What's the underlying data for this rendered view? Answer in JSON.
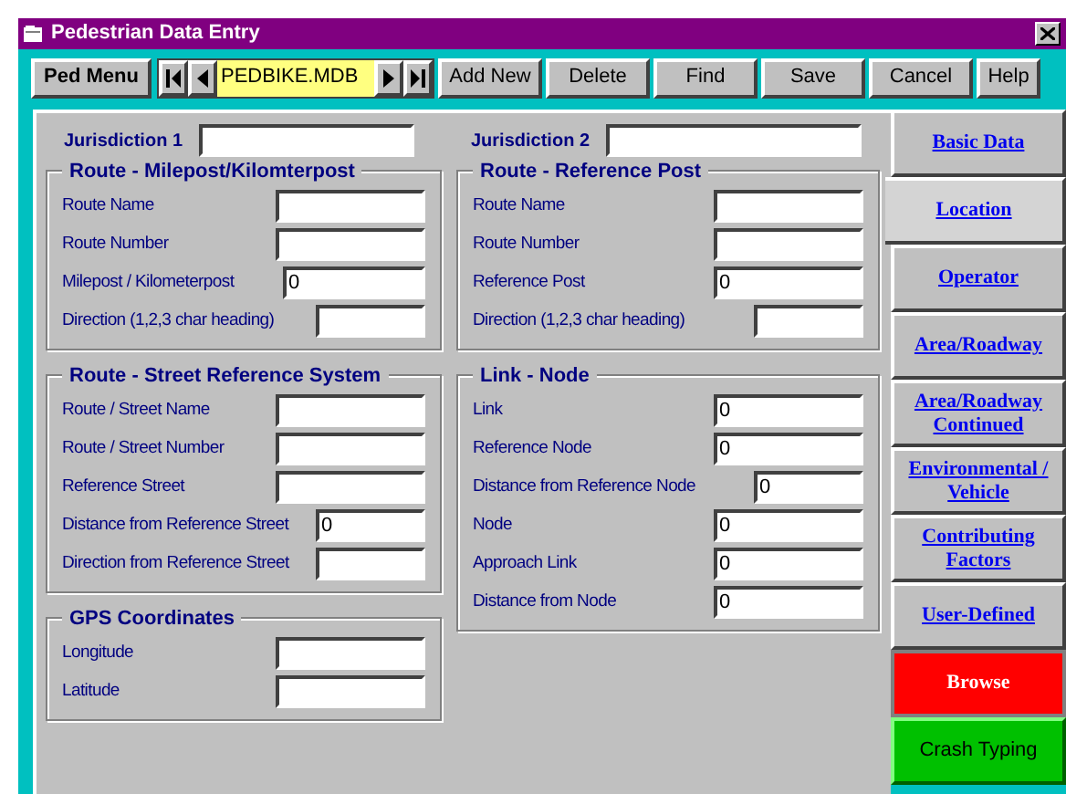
{
  "window": {
    "title": "Pedestrian Data Entry"
  },
  "toolbar": {
    "menu_button": "Ped Menu",
    "database": "PEDBIKE.MDB",
    "buttons": [
      "Add New",
      "Delete",
      "Find",
      "Save",
      "Cancel",
      "Help"
    ]
  },
  "jurisdictions": [
    {
      "label": "Jurisdiction 1"
    },
    {
      "label": "Jurisdiction 2"
    }
  ],
  "left_column": [
    {
      "title": "Route - Milepost/Kilomterpost",
      "fields": [
        {
          "label": "Route Name"
        },
        {
          "label": "Route Number"
        },
        {
          "label": "Milepost / Kilometerpost",
          "value": "0"
        },
        {
          "label": "Direction (1,2,3 char heading)"
        }
      ]
    },
    {
      "title": "Route - Street Reference System",
      "fields": [
        {
          "label": "Route / Street Name"
        },
        {
          "label": "Route / Street Number"
        },
        {
          "label": "Reference Street"
        },
        {
          "label": "Distance from Reference Street",
          "value": "0"
        },
        {
          "label": "Direction from Reference Street"
        }
      ]
    },
    {
      "title": "GPS Coordinates",
      "fields": [
        {
          "label": "Longitude"
        },
        {
          "label": "Latitude"
        }
      ]
    }
  ],
  "right_column": [
    {
      "title": "Route - Reference Post",
      "fields": [
        {
          "label": "Route Name"
        },
        {
          "label": "Route Number"
        },
        {
          "label": "Reference Post",
          "value": "0"
        },
        {
          "label": "Direction (1,2,3 char heading)"
        }
      ]
    },
    {
      "title": "Link - Node",
      "fields": [
        {
          "label": "Link",
          "value": "0"
        },
        {
          "label": "Reference Node",
          "value": "0"
        },
        {
          "label": "Distance from Reference Node",
          "value": "0"
        },
        {
          "label": "Node",
          "value": "0"
        },
        {
          "label": "Approach Link",
          "value": "0"
        },
        {
          "label": "Distance from Node",
          "value": "0"
        }
      ]
    }
  ],
  "tabs": [
    {
      "label": "Basic Data",
      "selected": false
    },
    {
      "label": "Location",
      "selected": true
    },
    {
      "label": "Operator",
      "selected": false
    },
    {
      "label": "Area/Roadway",
      "selected": false
    },
    {
      "label": "Area/Roadway Continued",
      "selected": false
    },
    {
      "label": "Environmental / Vehicle",
      "selected": false
    },
    {
      "label": "Contributing Factors",
      "selected": false
    },
    {
      "label": "User-Defined",
      "selected": false
    }
  ],
  "action_buttons": [
    {
      "kind": "alert",
      "label": "Browse"
    },
    {
      "kind": "go",
      "label": "Crash Typing"
    }
  ]
}
